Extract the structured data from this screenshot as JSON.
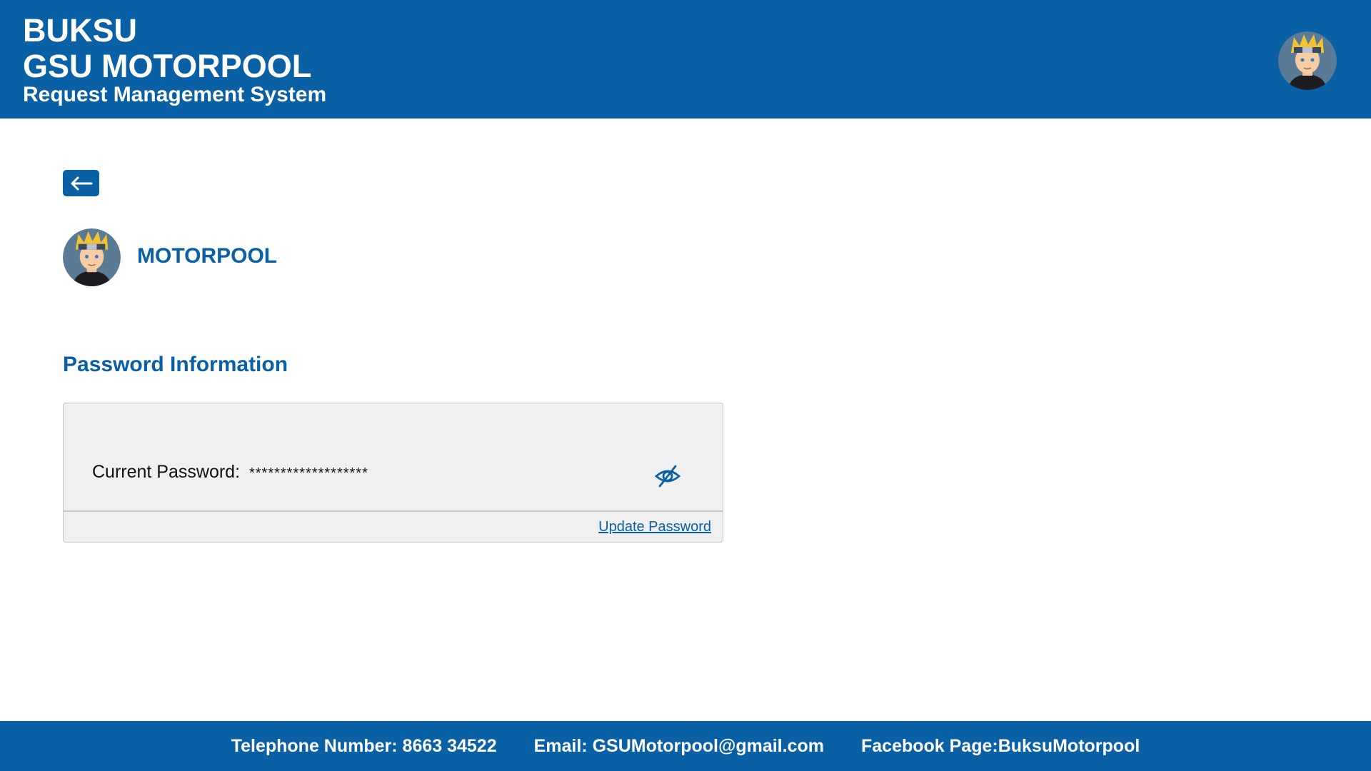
{
  "header": {
    "brand_line1": "BUKSU",
    "brand_line2": "GSU MOTORPOOL",
    "brand_line3": "Request Management System",
    "avatar_icon": "user-avatar-icon"
  },
  "navigation": {
    "back_icon": "arrow-left-icon"
  },
  "profile": {
    "name": "MOTORPOOL"
  },
  "password_section": {
    "title": "Password Information",
    "current_label": "Current Password:",
    "current_value": "*******************",
    "toggle_icon": "eye-slash-icon",
    "update_link": "Update Password"
  },
  "footer": {
    "telephone": "Telephone Number: 8663 34522",
    "email": "Email: GSUMotorpool@gmail.com",
    "facebook": "Facebook Page:BuksuMotorpool"
  },
  "colors": {
    "brand_blue": "#0a60a4",
    "card_background": "#f0f0f0",
    "card_border": "#c7c7c7"
  }
}
